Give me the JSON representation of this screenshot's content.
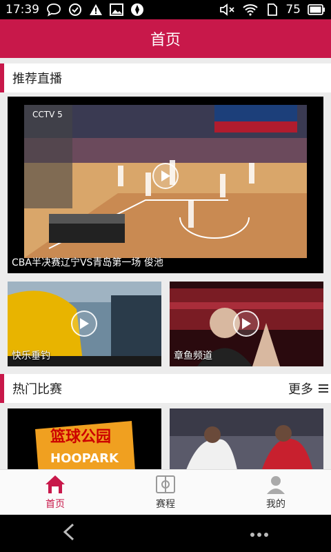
{
  "status_bar": {
    "time": "17:39",
    "battery": "75",
    "icons": [
      "chat-icon",
      "sync-icon",
      "warning-icon",
      "image-icon",
      "app-icon",
      "mute-icon",
      "wifi-icon",
      "sim-icon",
      "battery-icon"
    ]
  },
  "header": {
    "title": "首页"
  },
  "sections": {
    "live": {
      "title": "推荐直播"
    },
    "hot": {
      "title": "热门比赛",
      "more_label": "更多"
    }
  },
  "cards": {
    "main": {
      "caption": "CBA半决赛辽宁VS青岛第一场 俊池"
    },
    "fishing": {
      "caption": "快乐垂钓"
    },
    "octopus": {
      "caption": "章鱼频道"
    },
    "hoopark": {
      "logo_text": "HOOPARK",
      "logo_cn": "篮球公园"
    },
    "nba": {}
  },
  "bottom_nav": {
    "items": [
      {
        "label": "首页",
        "icon": "home-icon",
        "active": true
      },
      {
        "label": "赛程",
        "icon": "schedule-icon",
        "active": false
      },
      {
        "label": "我的",
        "icon": "profile-icon",
        "active": false
      }
    ]
  },
  "colors": {
    "brand": "#c8184a",
    "active_nav": "#c8184a"
  }
}
